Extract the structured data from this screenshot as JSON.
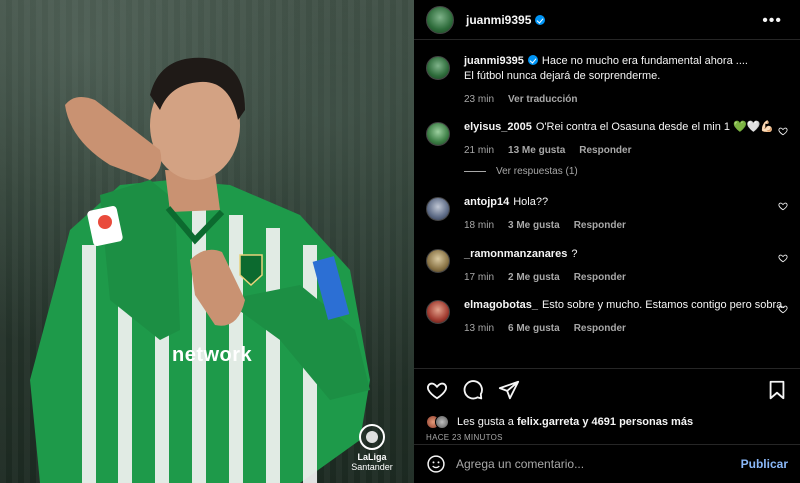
{
  "post": {
    "author": "juanmi9395",
    "caption_line1": "Hace no mucho era fundamental ahora ....",
    "caption_line2": "El fútbol nunca dejará de sorprenderme.",
    "caption_time": "23 min",
    "translate_label": "Ver traducción"
  },
  "photo": {
    "sponsor_text": "network",
    "logo_line1": "LaLiga",
    "logo_line2": "Santander"
  },
  "comments": [
    {
      "user": "elyisus_2005",
      "text": "O'Rei contra el Osasuna desde el min 1 💚🤍💪🏻",
      "time": "21 min",
      "likes": "13 Me gusta",
      "reply": "Responder"
    },
    {
      "user": "antojp14",
      "text": "Hola??",
      "time": "18 min",
      "likes": "3 Me gusta",
      "reply": "Responder"
    },
    {
      "user": "_ramonmanzanares",
      "text": "?",
      "time": "17 min",
      "likes": "2 Me gusta",
      "reply": "Responder"
    },
    {
      "user": "elmagobotas_",
      "text": "Esto sobre y mucho. Estamos contigo pero sobra.",
      "time": "13 min",
      "likes": "6 Me gusta",
      "reply": "Responder"
    }
  ],
  "view_replies": "Ver respuestas (1)",
  "likes_bar": {
    "prefix": "Les gusta a",
    "user": "felix.garreta",
    "suffix": "y 4691 personas más"
  },
  "posted_ago": "HACE 23 MINUTOS",
  "comment_input": {
    "placeholder": "Agrega un comentario...",
    "publish": "Publicar"
  },
  "colors": {
    "accent": "#0095f6",
    "publish": "#8ab8f8",
    "jersey_green": "#1e9a4a"
  },
  "icons": [
    "more-icon",
    "heart-icon",
    "comment-icon",
    "share-icon",
    "bookmark-icon",
    "emoji-icon",
    "verified-icon"
  ]
}
